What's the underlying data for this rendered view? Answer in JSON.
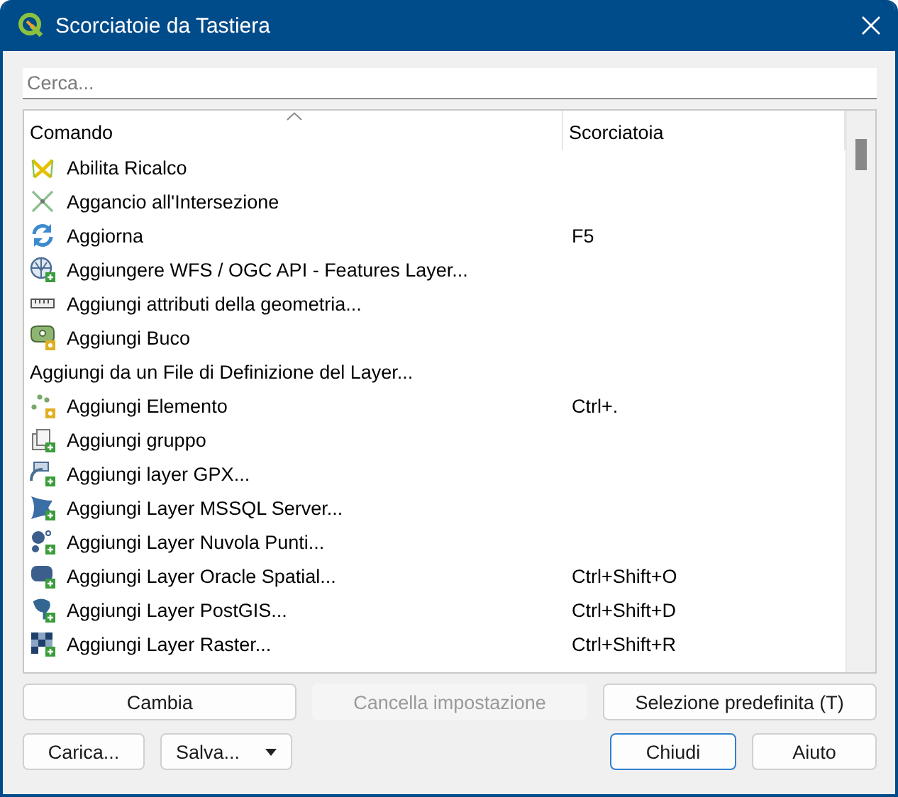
{
  "window": {
    "title": "Scorciatoie da Tastiera"
  },
  "search": {
    "placeholder": "Cerca..."
  },
  "table": {
    "columns": [
      {
        "label": "Comando",
        "sorted": true
      },
      {
        "label": "Scorciatoia",
        "sorted": false
      }
    ],
    "rows": [
      {
        "kind": "snap-trace",
        "command": "Abilita Ricalco",
        "shortcut": ""
      },
      {
        "kind": "intersection",
        "command": "Aggancio all'Intersezione",
        "shortcut": ""
      },
      {
        "kind": "refresh",
        "command": "Aggiorna",
        "shortcut": "F5"
      },
      {
        "kind": "wfs",
        "command": "Aggiungere WFS / OGC API - Features Layer...",
        "shortcut": ""
      },
      {
        "kind": "ruler",
        "command": "Aggiungi attributi della geometria...",
        "shortcut": ""
      },
      {
        "kind": "hole",
        "command": "Aggiungi Buco",
        "shortcut": ""
      },
      {
        "kind": "plain",
        "command": "Aggiungi da un File di Definizione del Layer...",
        "shortcut": ""
      },
      {
        "kind": "points",
        "command": "Aggiungi Elemento",
        "shortcut": "Ctrl+."
      },
      {
        "kind": "group",
        "command": "Aggiungi gruppo",
        "shortcut": ""
      },
      {
        "kind": "gpx",
        "command": "Aggiungi layer GPX...",
        "shortcut": ""
      },
      {
        "kind": "mssql",
        "command": "Aggiungi Layer MSSQL Server...",
        "shortcut": ""
      },
      {
        "kind": "pointcloud",
        "command": "Aggiungi Layer Nuvola Punti...",
        "shortcut": ""
      },
      {
        "kind": "oracle",
        "command": "Aggiungi Layer Oracle Spatial...",
        "shortcut": "Ctrl+Shift+O"
      },
      {
        "kind": "postgis",
        "command": "Aggiungi Layer PostGIS...",
        "shortcut": "Ctrl+Shift+D"
      },
      {
        "kind": "raster",
        "command": "Aggiungi Layer Raster...",
        "shortcut": "Ctrl+Shift+R"
      }
    ]
  },
  "action_buttons": [
    {
      "label": "Cambia",
      "disabled": false
    },
    {
      "label": "Cancella impostazione",
      "disabled": true
    },
    {
      "label": "Selezione predefinita (T)",
      "disabled": false
    }
  ],
  "bottom_buttons": [
    {
      "label": "Carica...",
      "dropdown": false,
      "default": false
    },
    {
      "label": "Salva...",
      "dropdown": true,
      "default": false
    },
    {
      "label": "Chiudi",
      "dropdown": false,
      "default": true
    },
    {
      "label": "Aiuto",
      "dropdown": false,
      "default": false
    }
  ]
}
